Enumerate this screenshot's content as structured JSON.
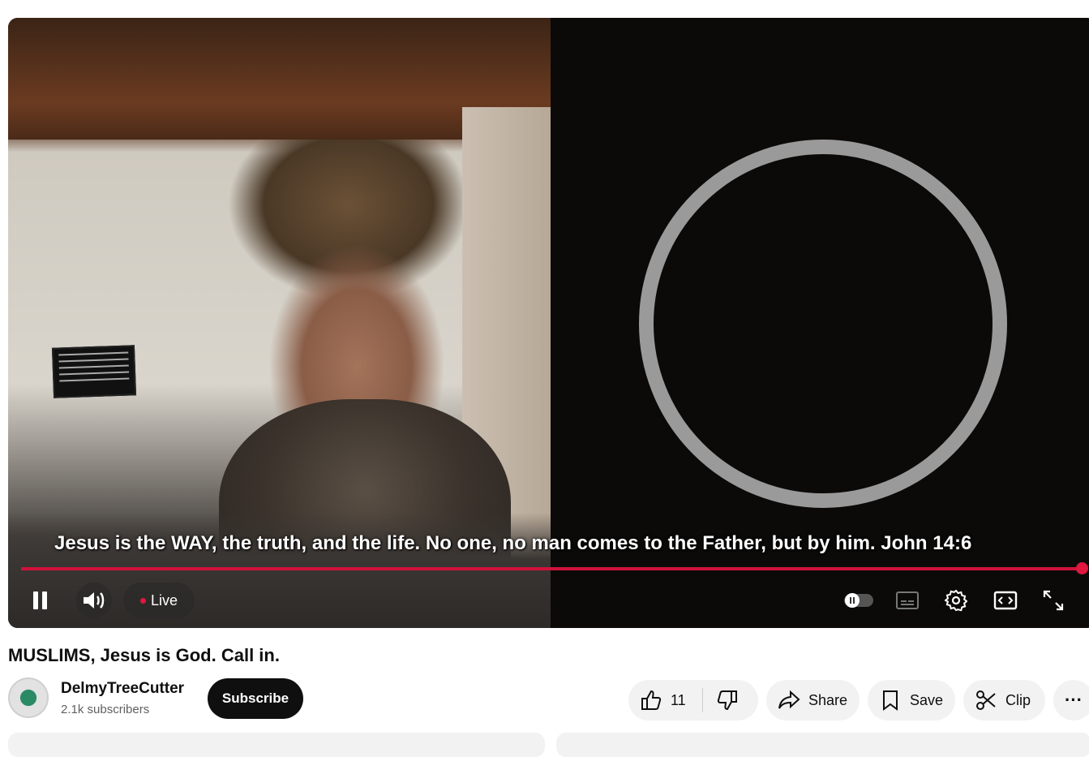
{
  "video": {
    "caption": "Jesus is the WAY, the truth, and the life. No one, no man comes to the Father, but by him. John 14:6",
    "live_label": "Live",
    "title": "MUSLIMS, Jesus is God. Call in."
  },
  "channel": {
    "name": "DelmyTreeCutter",
    "subscribers": "2.1k subscribers",
    "subscribe_label": "Subscribe"
  },
  "actions": {
    "like_count": "11",
    "share_label": "Share",
    "save_label": "Save",
    "clip_label": "Clip",
    "more_label": "···"
  },
  "colors": {
    "accent": "#e0173f",
    "button_bg": "#f2f2f2",
    "subscribe_bg": "#0f0f0f"
  }
}
